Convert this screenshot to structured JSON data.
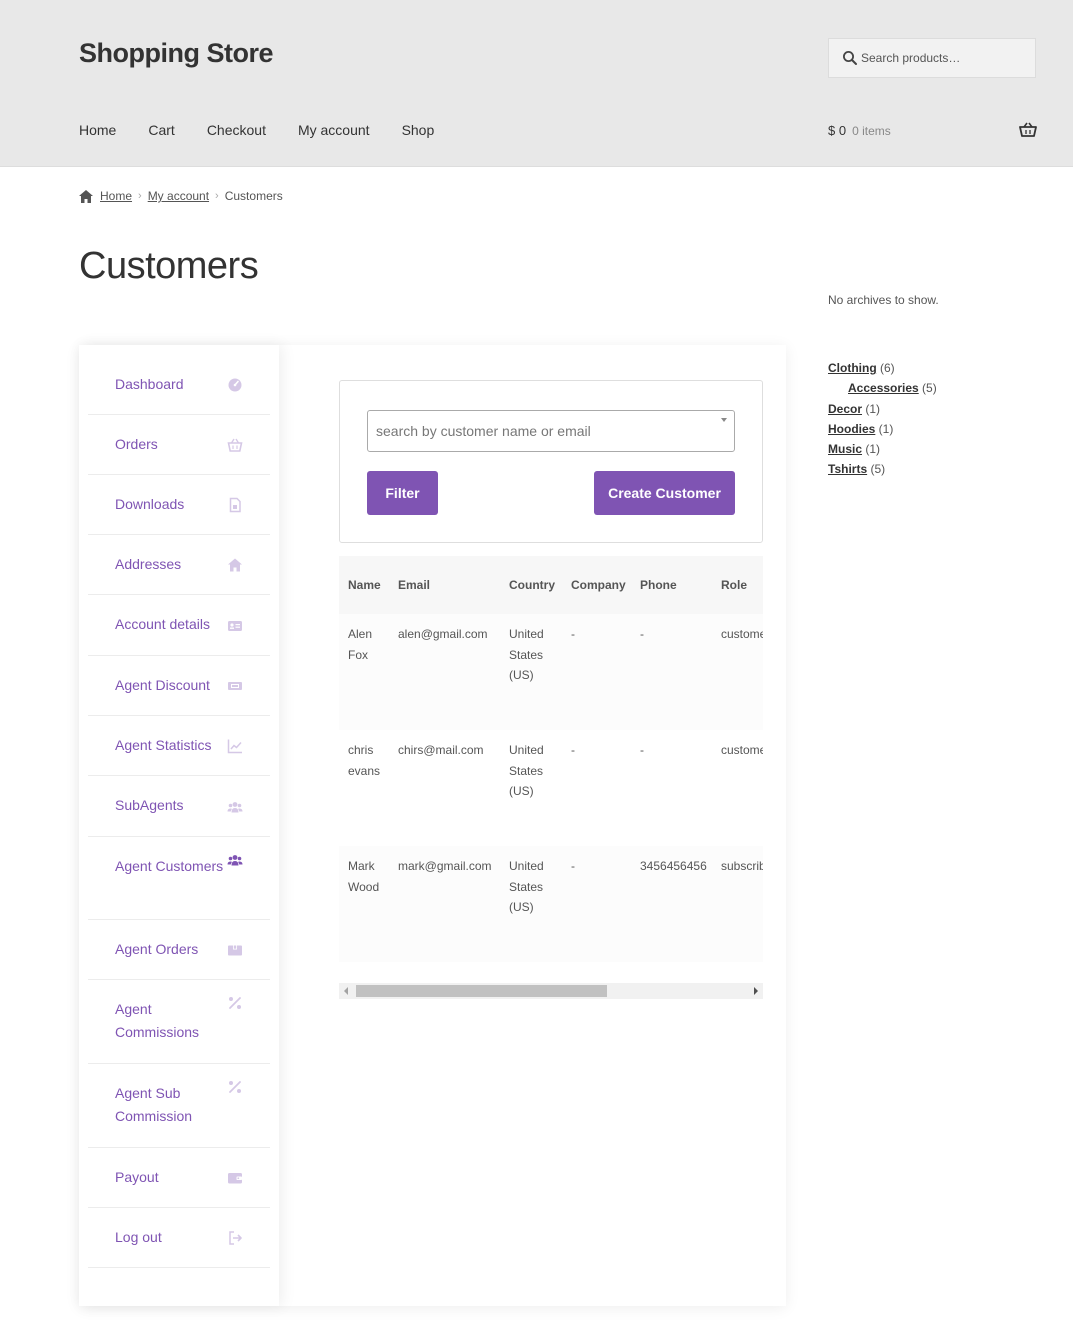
{
  "header": {
    "site_title": "Shopping Store",
    "search_placeholder": "Search products…",
    "nav": [
      "Home",
      "Cart",
      "Checkout",
      "My account",
      "Shop"
    ],
    "cart_amount": "$ 0",
    "cart_count": "0 items"
  },
  "breadcrumb": {
    "home": "Home",
    "account": "My account",
    "current": "Customers"
  },
  "page_title": "Customers",
  "menu": [
    {
      "label": "Dashboard",
      "icon": "gauge-icon",
      "active": false
    },
    {
      "label": "Orders",
      "icon": "basket-icon",
      "active": false
    },
    {
      "label": "Downloads",
      "icon": "file-icon",
      "active": false
    },
    {
      "label": "Addresses",
      "icon": "home-icon",
      "active": false
    },
    {
      "label": "Account details",
      "icon": "id-card-icon",
      "active": false
    },
    {
      "label": "Agent Discount",
      "icon": "ticket-icon",
      "active": false
    },
    {
      "label": "Agent Statistics",
      "icon": "chart-line-icon",
      "active": false
    },
    {
      "label": "SubAgents",
      "icon": "users-icon",
      "active": false
    },
    {
      "label": "Agent Customers",
      "icon": "users-icon",
      "active": true
    },
    {
      "label": "Agent Orders",
      "icon": "box-icon",
      "active": false
    },
    {
      "label": "Agent Commissions",
      "icon": "percent-icon",
      "active": false
    },
    {
      "label": "Agent Sub Commission",
      "icon": "percent-icon",
      "active": false
    },
    {
      "label": "Payout",
      "icon": "wallet-icon",
      "active": false
    },
    {
      "label": "Log out",
      "icon": "sign-out-icon",
      "active": false
    }
  ],
  "filter": {
    "search_placeholder": "search by customer name or email",
    "filter_label": "Filter",
    "create_label": "Create Customer"
  },
  "table": {
    "headers": [
      "Name",
      "Email",
      "Country",
      "Company",
      "Phone",
      "Role"
    ],
    "rows": [
      {
        "name": "Alen Fox",
        "email": "alen@gmail.com",
        "country": "United States (US)",
        "company": "-",
        "phone": "-",
        "role": "customer"
      },
      {
        "name": "chris evans",
        "email": "chirs@mail.com",
        "country": "United States (US)",
        "company": "-",
        "phone": "-",
        "role": "customer"
      },
      {
        "name": "Mark Wood",
        "email": "mark@gmail.com",
        "country": "United States (US)",
        "company": "-",
        "phone": "3456456456",
        "role": "subscriber"
      }
    ]
  },
  "sidebar": {
    "no_archives": "No archives to show.",
    "categories": [
      {
        "name": "Clothing",
        "count": "(6)",
        "child": false
      },
      {
        "name": "Accessories",
        "count": "(5)",
        "child": true
      },
      {
        "name": "Decor",
        "count": "(1)",
        "child": false
      },
      {
        "name": "Hoodies",
        "count": "(1)",
        "child": false
      },
      {
        "name": "Music",
        "count": "(1)",
        "child": false
      },
      {
        "name": "Tshirts",
        "count": "(5)",
        "child": false
      }
    ]
  },
  "colors": {
    "accent": "#7f54b3",
    "icon_muted": "#d5c8e6",
    "header_bg": "#e8e8e8"
  }
}
